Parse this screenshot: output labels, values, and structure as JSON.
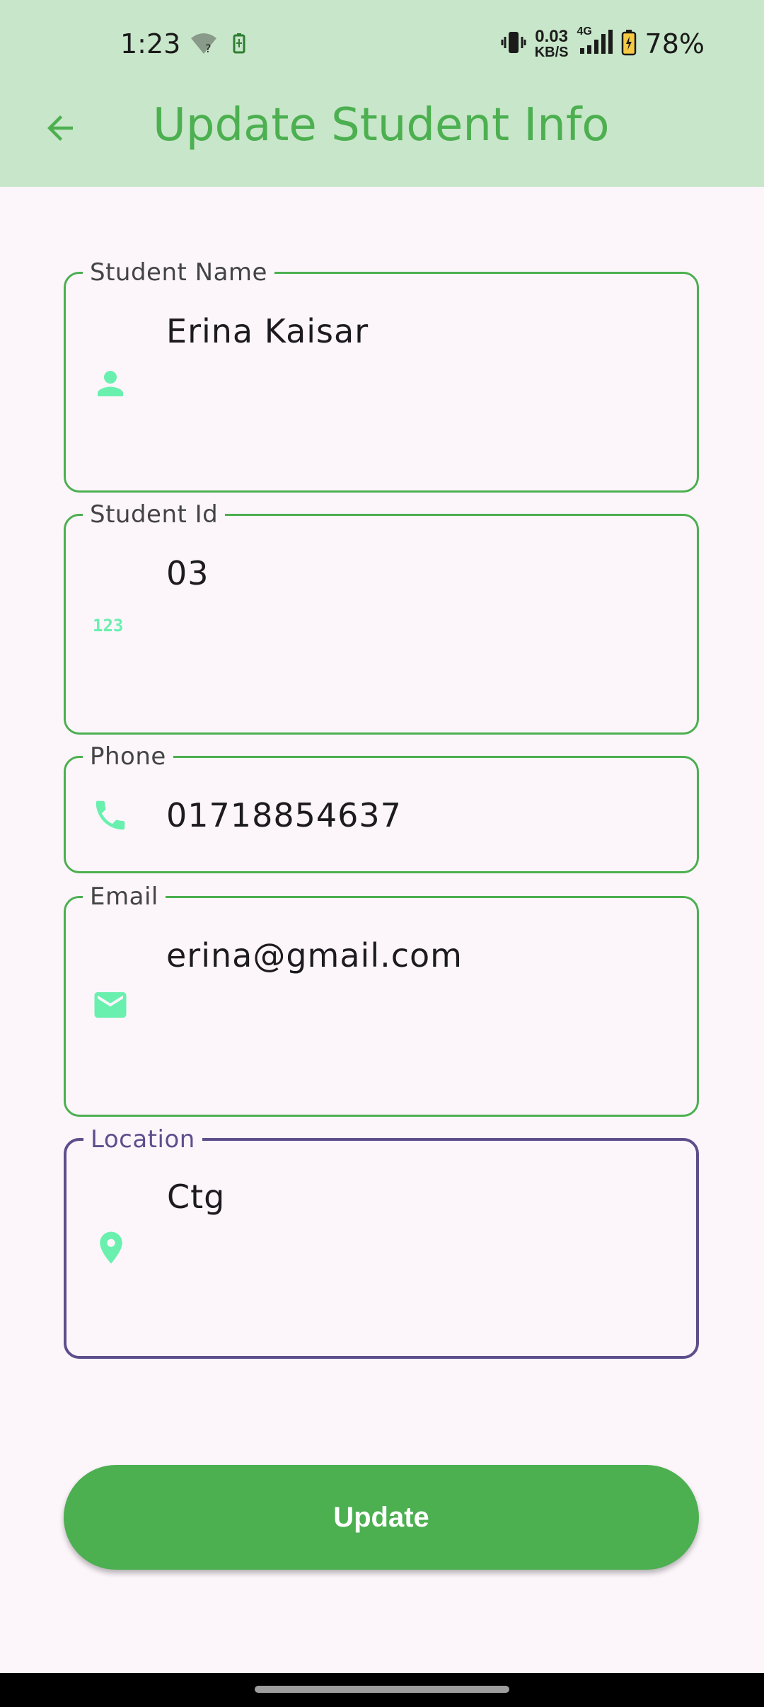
{
  "status_bar": {
    "time": "1:23",
    "net_speed_value": "0.03",
    "net_speed_unit": "KB/S",
    "network_type": "4G",
    "battery_percent": "78%"
  },
  "app_bar": {
    "title": "Update Student Info",
    "back_icon": "arrow-back-icon"
  },
  "form": {
    "fields": [
      {
        "label": "Student Name",
        "value": "Erina Kaisar",
        "icon": "person-icon"
      },
      {
        "label": "Student Id",
        "value": "03",
        "icon": "number-123-icon"
      },
      {
        "label": "Phone",
        "value": "01718854637",
        "icon": "phone-icon"
      },
      {
        "label": "Email",
        "value": "erina@gmail.com",
        "icon": "mail-icon"
      },
      {
        "label": "Location",
        "value": "Ctg",
        "icon": "location-pin-icon",
        "focused": true
      }
    ],
    "submit_label": "Update"
  },
  "colors": {
    "accent": "#4caf50",
    "app_bar_bg": "#c8e6c9",
    "icon_tint": "#69f0ae",
    "focus_border": "#5e4e8c"
  }
}
